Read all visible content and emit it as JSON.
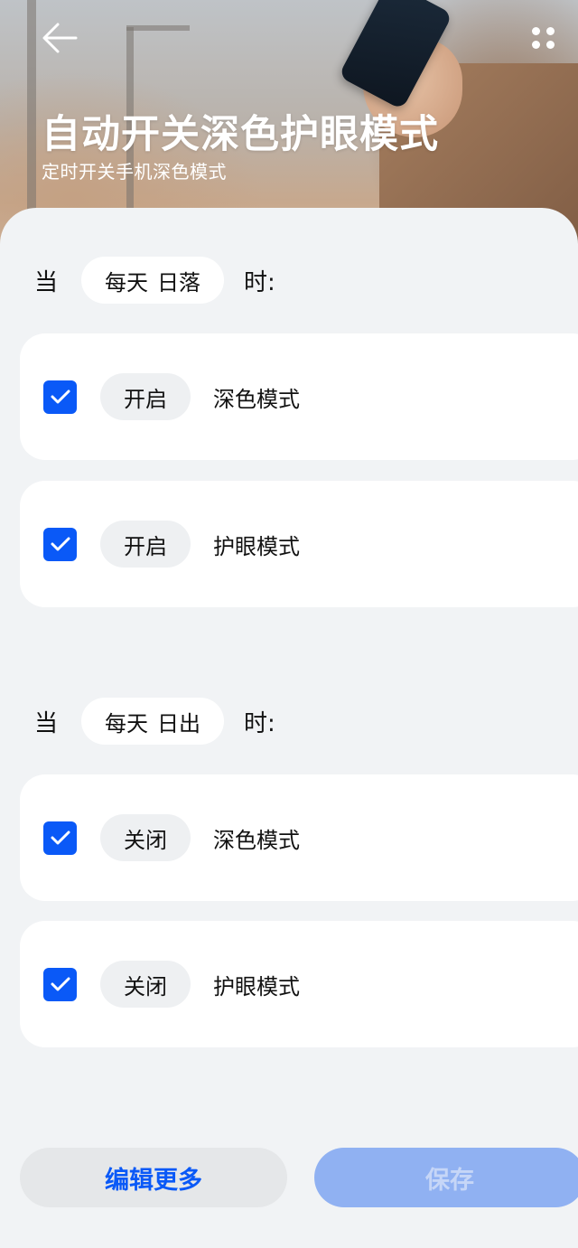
{
  "header": {
    "title": "自动开关深色护眼模式",
    "subtitle": "定时开关手机深色模式"
  },
  "sections": [
    {
      "condition": {
        "when": "当",
        "frequency": "每天",
        "event": "日落",
        "colon": "时:"
      },
      "rows": [
        {
          "checked": true,
          "action": "开启",
          "mode": "深色模式"
        },
        {
          "checked": true,
          "action": "开启",
          "mode": "护眼模式"
        }
      ]
    },
    {
      "condition": {
        "when": "当",
        "frequency": "每天",
        "event": "日出",
        "colon": "时:"
      },
      "rows": [
        {
          "checked": true,
          "action": "关闭",
          "mode": "深色模式"
        },
        {
          "checked": true,
          "action": "关闭",
          "mode": "护眼模式"
        }
      ]
    }
  ],
  "footer": {
    "edit_label": "编辑更多",
    "save_label": "保存"
  },
  "colors": {
    "accent": "#0a59f7",
    "background": "#f1f3f5",
    "save_disabled": "#90b1f2"
  },
  "icons": {
    "back": "back-arrow-icon",
    "more": "more-dots-icon",
    "check": "checkmark-icon"
  }
}
